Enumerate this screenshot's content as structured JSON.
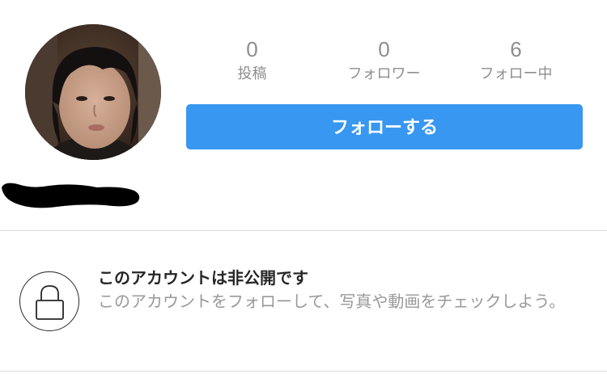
{
  "profile": {
    "avatar_icon": "profile-photo",
    "redacted": true
  },
  "stats": {
    "posts": {
      "count": "0",
      "label": "投稿"
    },
    "followers": {
      "count": "0",
      "label": "フォロワー"
    },
    "following": {
      "count": "6",
      "label": "フォロー中"
    }
  },
  "follow_button": {
    "label": "フォローする",
    "color": "#3897f0"
  },
  "private_account": {
    "icon": "lock-icon",
    "title": "このアカウントは非公開です",
    "description": "このアカウントをフォローして、写真や動画をチェックしよう。"
  }
}
